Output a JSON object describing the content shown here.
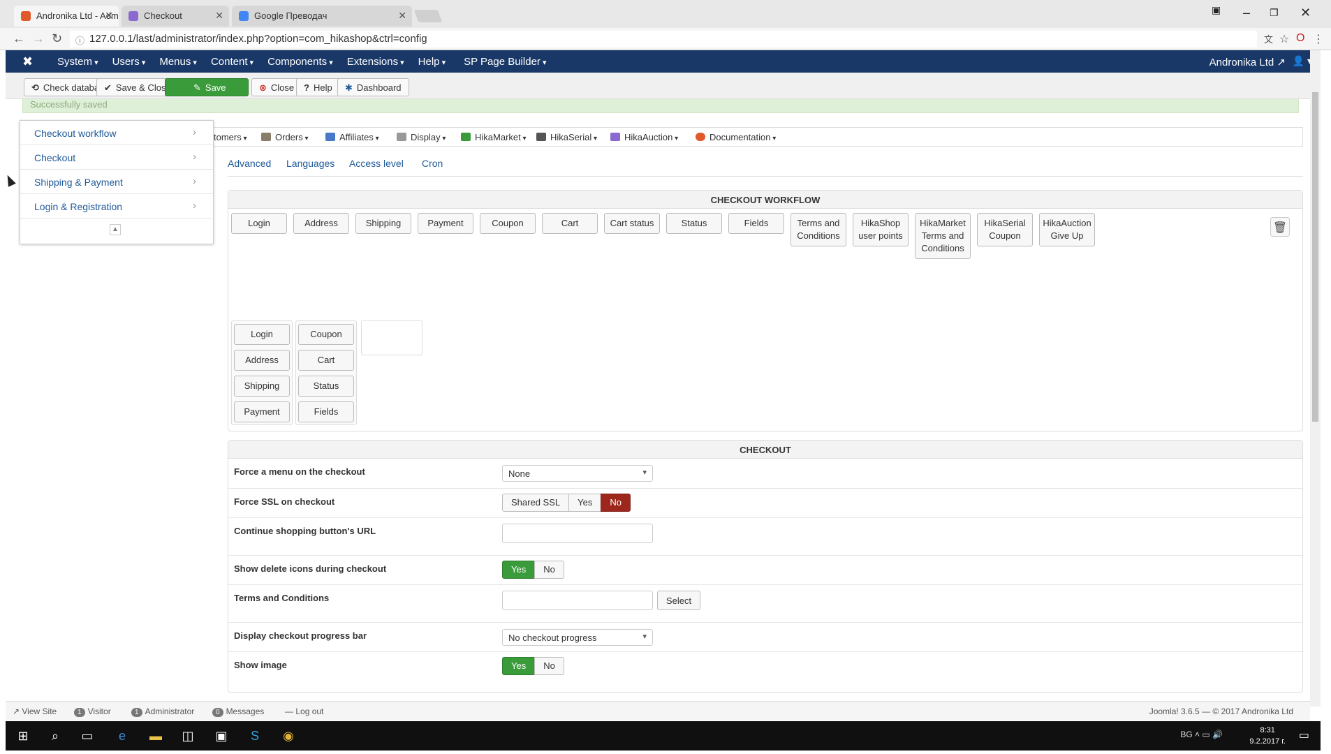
{
  "browser": {
    "tabs": [
      {
        "label": "Andronika Ltd - Administ",
        "color": "#e05a2b"
      },
      {
        "label": "Checkout",
        "color": "#8a6ad0"
      },
      {
        "label": "Google Преводач",
        "color": "#4285f4"
      }
    ],
    "url": "127.0.0.1/last/administrator/index.php?option=com_hikashop&ctrl=config"
  },
  "joomla": {
    "menu": [
      "System",
      "Users",
      "Menus",
      "Content",
      "Components",
      "Extensions",
      "Help",
      "SP Page Builder"
    ],
    "site_name": "Andronika Ltd"
  },
  "toolbar": {
    "check_database": "Check database",
    "save_close": "Save & Close",
    "save": "Save",
    "close": "Close",
    "help": "Help",
    "dashboard": "Dashboard"
  },
  "message": "Successfully saved",
  "sidebar": {
    "items": [
      "Checkout workflow",
      "Checkout",
      "Shipping & Payment",
      "Login & Registration"
    ]
  },
  "subnav": {
    "items": [
      "tomers",
      "Orders",
      "Affiliates",
      "Display",
      "HikaMarket",
      "HikaSerial",
      "HikaAuction",
      "Documentation"
    ]
  },
  "config_tabs": [
    "Advanced",
    "Languages",
    "Access level",
    "Cron"
  ],
  "workflow": {
    "title": "CHECKOUT WORKFLOW",
    "available": [
      "Login",
      "Address",
      "Shipping",
      "Payment",
      "Coupon",
      "Cart",
      "Cart status",
      "Status",
      "Fields",
      "Terms and Conditions",
      "HikaShop user points",
      "HikaMarket Terms and Conditions",
      "HikaSerial Coupon",
      "HikaAuction Give Up"
    ],
    "step1": [
      "Login",
      "Address",
      "Shipping",
      "Payment"
    ],
    "step2": [
      "Coupon",
      "Cart",
      "Status",
      "Fields"
    ]
  },
  "checkout": {
    "title": "CHECKOUT",
    "force_menu_label": "Force a menu on the checkout",
    "force_menu_value": "None",
    "force_ssl_label": "Force SSL on checkout",
    "ssl_options": [
      "Shared SSL",
      "Yes",
      "No"
    ],
    "continue_url_label": "Continue shopping button's URL",
    "continue_url_value": "",
    "delete_icons_label": "Show delete icons during checkout",
    "terms_label": "Terms and Conditions",
    "terms_value": "",
    "select_label": "Select",
    "progress_label": "Display checkout progress bar",
    "progress_value": "No checkout progress",
    "show_image_label": "Show image",
    "yes": "Yes",
    "no": "No"
  },
  "status": {
    "view_site": "View Site",
    "visitor_count": "1",
    "visitor": "Visitor",
    "admin_count": "1",
    "administrator": "Administrator",
    "messages_count": "0",
    "messages": "Messages",
    "logout": "Log out",
    "copyright": "Joomla! 3.6.5 — © 2017 Andronika Ltd"
  },
  "taskbar": {
    "lang": "BG",
    "time": "8:31",
    "date": "9.2.2017 г."
  },
  "colors": {
    "nav_bg": "#1a3867",
    "green": "#3a9b3a",
    "red": "#9d261d",
    "link": "#1f5a99"
  }
}
